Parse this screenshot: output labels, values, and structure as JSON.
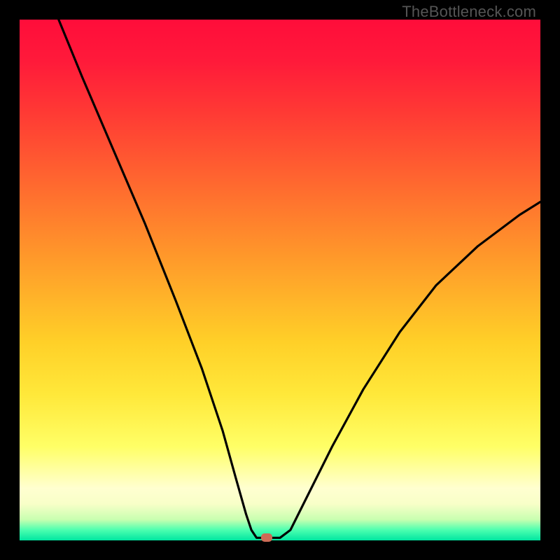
{
  "watermark": "TheBottleneck.com",
  "chart_data": {
    "type": "line",
    "title": "",
    "xlabel": "",
    "ylabel": "",
    "xlim": [
      0,
      1
    ],
    "ylim": [
      0,
      1
    ],
    "grid": false,
    "legend": false,
    "series": [
      {
        "name": "curve",
        "x": [
          0.075,
          0.12,
          0.18,
          0.24,
          0.3,
          0.35,
          0.39,
          0.415,
          0.435,
          0.445,
          0.455,
          0.5,
          0.52,
          0.55,
          0.6,
          0.66,
          0.73,
          0.8,
          0.88,
          0.96,
          1.0
        ],
        "y": [
          1.0,
          0.89,
          0.75,
          0.61,
          0.46,
          0.33,
          0.21,
          0.12,
          0.05,
          0.02,
          0.005,
          0.005,
          0.02,
          0.08,
          0.18,
          0.29,
          0.4,
          0.49,
          0.565,
          0.625,
          0.65
        ]
      }
    ],
    "annotations": [
      {
        "name": "min-marker",
        "x": 0.475,
        "y": 0.005,
        "shape": "rounded-rect",
        "color": "#cc6b56"
      }
    ],
    "gradient_stops": [
      {
        "pos": 0.0,
        "color": "#ff0d3a"
      },
      {
        "pos": 0.3,
        "color": "#ff6a2f"
      },
      {
        "pos": 0.62,
        "color": "#ffd028"
      },
      {
        "pos": 0.82,
        "color": "#ffff66"
      },
      {
        "pos": 0.93,
        "color": "#f8ffc8"
      },
      {
        "pos": 1.0,
        "color": "#00e6a0"
      }
    ]
  },
  "colors": {
    "frame": "#000000",
    "curve": "#000000",
    "marker": "#cc6b56",
    "watermark": "#555555"
  }
}
